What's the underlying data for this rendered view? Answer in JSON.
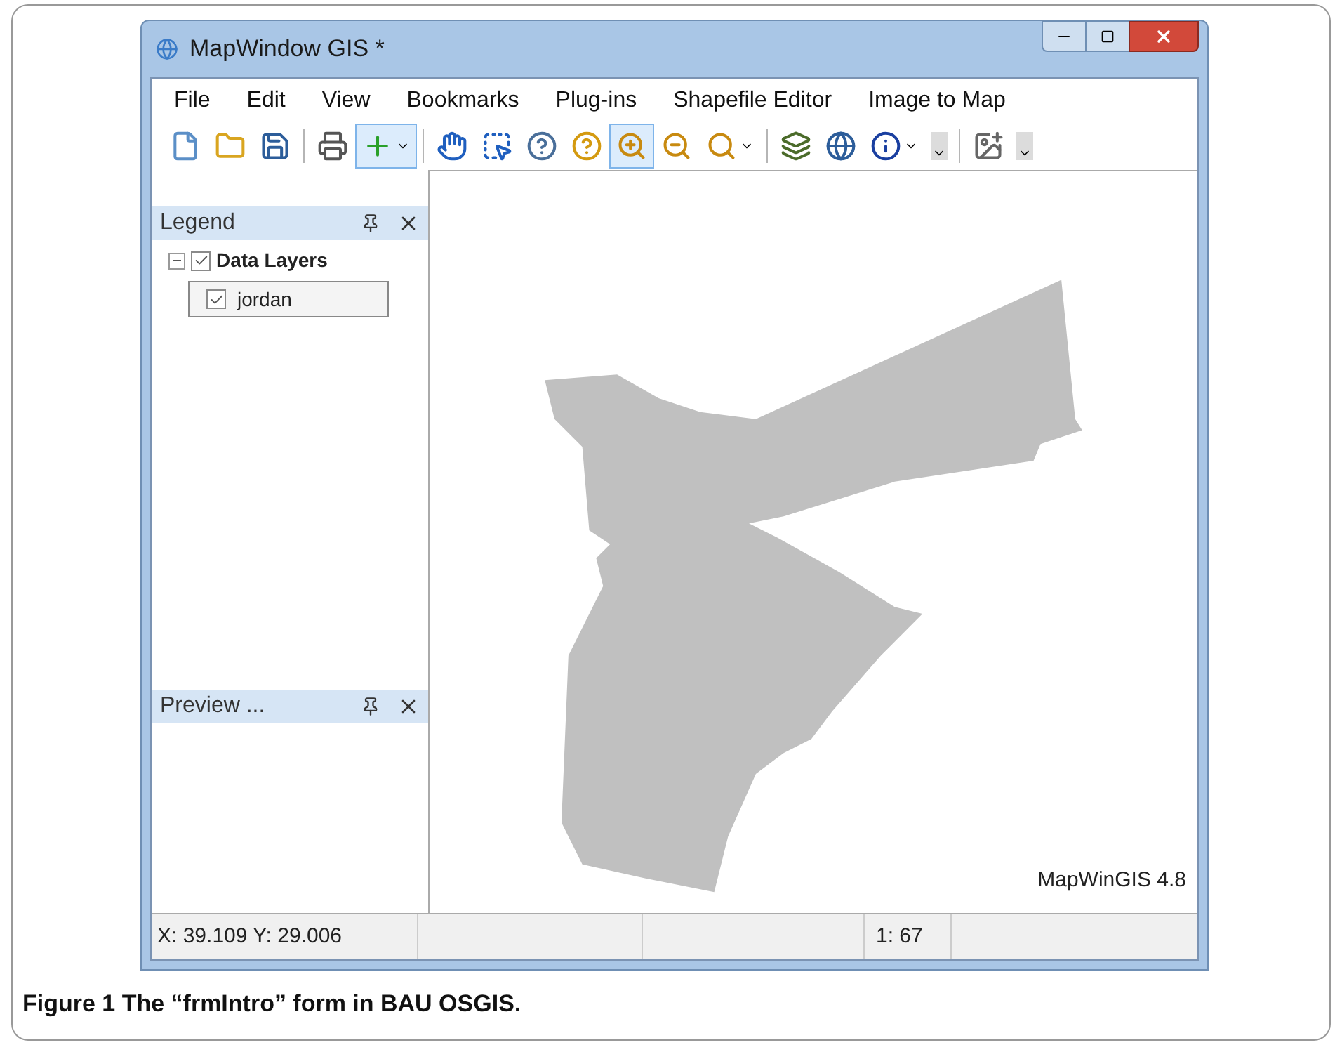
{
  "window": {
    "title": "MapWindow GIS *"
  },
  "menu": [
    "File",
    "Edit",
    "View",
    "Bookmarks",
    "Plug-ins",
    "Shapefile Editor",
    "Image to Map"
  ],
  "toolbar": [
    {
      "kind": "new",
      "selected": false
    },
    {
      "kind": "open",
      "selected": false
    },
    {
      "kind": "save",
      "selected": false
    },
    {
      "kind": "separator"
    },
    {
      "kind": "print",
      "selected": false
    },
    {
      "kind": "add",
      "selected": true
    },
    {
      "kind": "separator"
    },
    {
      "kind": "pan",
      "selected": false
    },
    {
      "kind": "select",
      "selected": false
    },
    {
      "kind": "help",
      "selected": false
    },
    {
      "kind": "help2",
      "selected": false
    },
    {
      "kind": "zoomin",
      "selected": true
    },
    {
      "kind": "zoomout",
      "selected": false
    },
    {
      "kind": "zoomdrop",
      "selected": false
    },
    {
      "kind": "separator"
    },
    {
      "kind": "layers",
      "selected": false
    },
    {
      "kind": "globe",
      "selected": false
    },
    {
      "kind": "info",
      "selected": false
    },
    {
      "kind": "overflow"
    },
    {
      "kind": "separator"
    },
    {
      "kind": "image",
      "selected": false
    },
    {
      "kind": "overflow"
    }
  ],
  "legend": {
    "title": "Legend",
    "items": [
      {
        "label": "Data Layers",
        "checked": true,
        "expanded": true,
        "children": [
          {
            "label": "jordan",
            "checked": true,
            "selected": true
          }
        ]
      }
    ]
  },
  "preview": {
    "title": "Preview ..."
  },
  "map": {
    "version": "MapWinGIS 4.8"
  },
  "status_bar": {
    "coordinates": "X: 39.109 Y: 29.006",
    "scale": "1: 67"
  },
  "caption": "Figure 1 The “frmIntro” form in BAU OSGIS."
}
